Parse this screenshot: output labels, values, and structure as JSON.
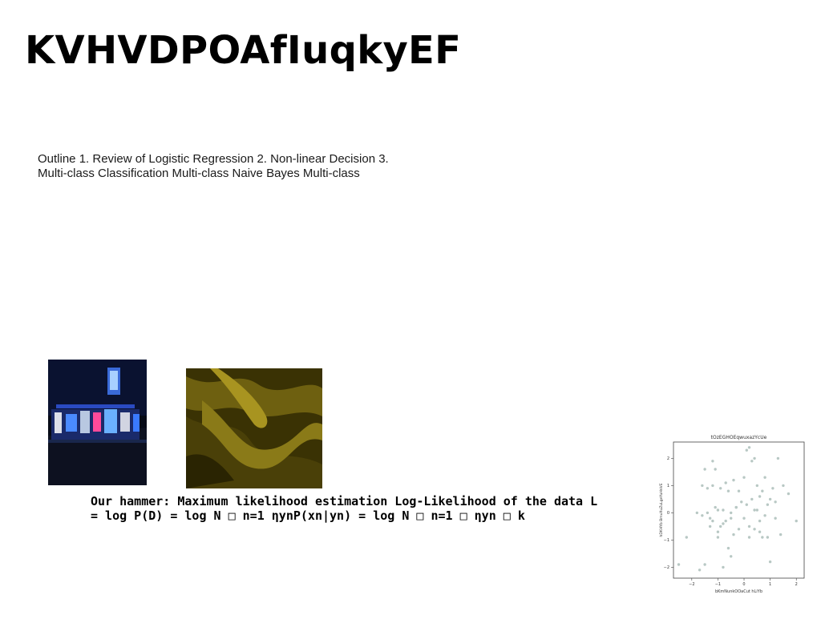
{
  "slide": {
    "title": "KVHVDPOAfIuqkyEF",
    "outline_text": "Outline 1. Review of Logistic Regression 2. Non-linear Decision 3. Multi-class Classification Multi-class Naive Bayes Multi-class",
    "hammer_text": "Our hammer: Maximum likelihood estimation Log-Likelihood of the data L = log P(D) = log N □ n=1 ηynP(xn|yn) = log N □ n=1 □ ηyn □ k"
  },
  "images": {
    "night_photo": "night street storefront with neon signs",
    "fabric_photo": "olive-yellow draped fabric texture"
  },
  "chart_data": {
    "type": "scatter",
    "title": "tOzEGHOEqwuxazYcUe",
    "xlabel": "bKmNunkOOaCut hLiYb",
    "ylabel": "hDKHYb BmvXuZuLgeYuHnVE",
    "xlim": [
      -2.7,
      2.3
    ],
    "ylim": [
      -2.4,
      2.6
    ],
    "xticks": [
      -2,
      -1,
      0,
      1,
      2
    ],
    "yticks": [
      -2,
      -1,
      0,
      1,
      2
    ],
    "grid": false,
    "point_color": "#b8c8c4",
    "x": [
      -2.5,
      -2.2,
      -1.8,
      -1.7,
      -1.6,
      -1.6,
      -1.5,
      -1.5,
      -1.4,
      -1.3,
      -1.3,
      -1.2,
      -1.2,
      -1.2,
      -1.1,
      -1.1,
      -1.0,
      -1.0,
      -1.0,
      -0.9,
      -0.9,
      -0.8,
      -0.8,
      -0.7,
      -0.7,
      -0.6,
      -0.6,
      -0.5,
      -0.5,
      -0.4,
      -0.4,
      -0.3,
      -0.2,
      -0.2,
      -0.1,
      0.0,
      0.0,
      0.1,
      0.1,
      0.2,
      0.2,
      0.3,
      0.3,
      0.4,
      0.4,
      0.5,
      0.5,
      0.6,
      0.6,
      0.7,
      0.7,
      0.8,
      0.8,
      0.9,
      1.0,
      1.0,
      1.1,
      1.2,
      1.3,
      1.4,
      1.5,
      1.7,
      2.0,
      -0.8,
      0.2,
      -0.3,
      0.6,
      -1.4,
      0.9,
      1.2,
      -0.5,
      0.4
    ],
    "y": [
      -1.9,
      -0.9,
      0.0,
      -2.1,
      1.0,
      -0.1,
      1.6,
      -1.9,
      0.9,
      -0.5,
      -0.2,
      1.0,
      1.9,
      -0.3,
      1.6,
      0.2,
      -0.7,
      0.1,
      -0.9,
      0.9,
      -0.5,
      0.1,
      -2.0,
      1.1,
      -0.3,
      -1.3,
      0.8,
      -1.6,
      0.0,
      -0.8,
      1.2,
      0.2,
      -0.6,
      0.8,
      0.4,
      1.3,
      -0.2,
      2.3,
      0.3,
      2.4,
      -0.9,
      1.9,
      0.5,
      2.0,
      -0.6,
      0.1,
      1.0,
      0.6,
      -0.3,
      0.8,
      -0.9,
      1.3,
      -0.1,
      0.3,
      0.5,
      -1.8,
      0.9,
      -0.2,
      2.0,
      -0.8,
      1.0,
      0.7,
      -0.3,
      -0.4,
      -0.5,
      0.2,
      -0.7,
      0.0,
      -0.9,
      0.4,
      -0.2,
      0.1
    ]
  }
}
